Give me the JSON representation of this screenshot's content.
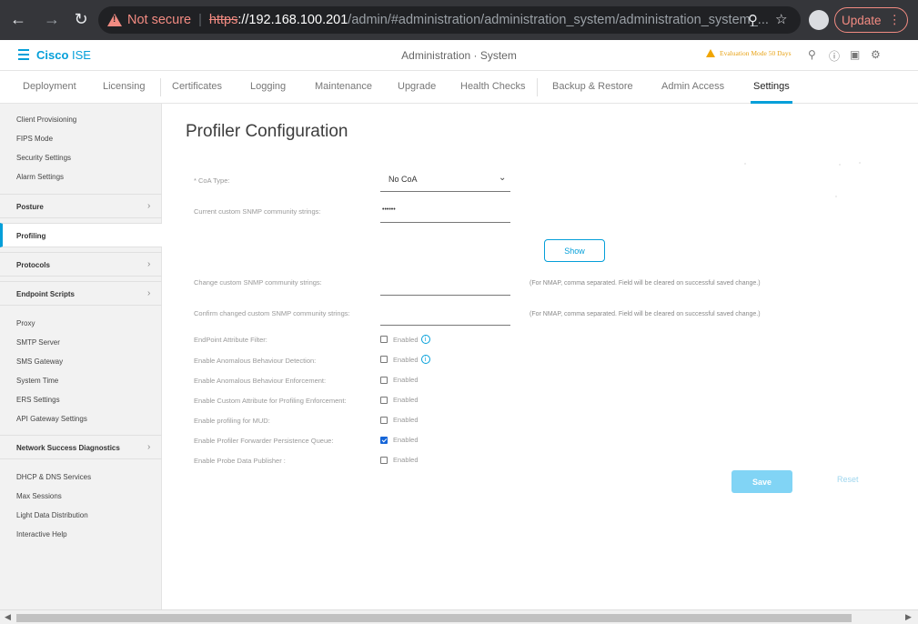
{
  "browser": {
    "not_secure": "Not secure",
    "url_scheme": "https",
    "url_host": "://192.168.100.201",
    "url_path": "/admin/#administration/administration_system/administration_system_...",
    "update_label": "Update"
  },
  "header": {
    "brand_bold": "Cisco",
    "brand_light": " ISE",
    "title": "Administration · System",
    "eval_text": "Evaluation Mode 50 Days"
  },
  "tabs": [
    {
      "label": "Deployment"
    },
    {
      "label": "Licensing"
    },
    {
      "label": "Certificates"
    },
    {
      "label": "Logging"
    },
    {
      "label": "Maintenance"
    },
    {
      "label": "Upgrade"
    },
    {
      "label": "Health Checks"
    },
    {
      "label": "Backup & Restore"
    },
    {
      "label": "Admin Access"
    },
    {
      "label": "Settings"
    }
  ],
  "sidebar": {
    "items_top": [
      "Client Provisioning",
      "FIPS Mode",
      "Security Settings",
      "Alarm Settings"
    ],
    "posture": "Posture",
    "profiling": "Profiling",
    "protocols": "Protocols",
    "endpoint_scripts": "Endpoint Scripts",
    "items_mid": [
      "Proxy",
      "SMTP Server",
      "SMS Gateway",
      "System Time",
      "ERS Settings",
      "API Gateway Settings"
    ],
    "network_success": "Network Success Diagnostics",
    "items_bottom": [
      "DHCP & DNS Services",
      "Max Sessions",
      "Light Data Distribution",
      "Interactive Help"
    ]
  },
  "form": {
    "title": "Profiler Configuration",
    "coa_label": "* CoA Type:",
    "coa_value": "No CoA",
    "snmp_current_label": "Current custom SNMP community strings:",
    "snmp_current_value": "••••••",
    "show_label": "Show",
    "snmp_change_label": "Change custom SNMP community strings:",
    "snmp_confirm_label": "Confirm changed custom SNMP community strings:",
    "hint": "(For NMAP, comma separated. Field will be cleared on successful saved change.)",
    "checkboxes": [
      {
        "label": "EndPoint Attribute Filter:",
        "text": "Enabled",
        "checked": false,
        "info": true
      },
      {
        "label": "Enable Anomalous Behaviour Detection:",
        "text": "Enabled",
        "checked": false,
        "info": true
      },
      {
        "label": "Enable Anomalous Behaviour Enforcement:",
        "text": "Enabled",
        "checked": false,
        "info": false
      },
      {
        "label": "Enable Custom Attribute for Profiling Enforcement:",
        "text": "Enabled",
        "checked": false,
        "info": false
      },
      {
        "label": "Enable profiling for MUD:",
        "text": "Enabled",
        "checked": false,
        "info": false
      },
      {
        "label": "Enable Profiler Forwarder Persistence Queue:",
        "text": "Enabled",
        "checked": true,
        "info": false
      },
      {
        "label": "Enable Probe Data Publisher :",
        "text": "Enabled",
        "checked": false,
        "info": false
      }
    ],
    "save_label": "Save",
    "reset_label": "Reset"
  },
  "colors": {
    "brand": "#049fd9",
    "warning": "#f0a500",
    "save_bg": "#81d4f5"
  }
}
